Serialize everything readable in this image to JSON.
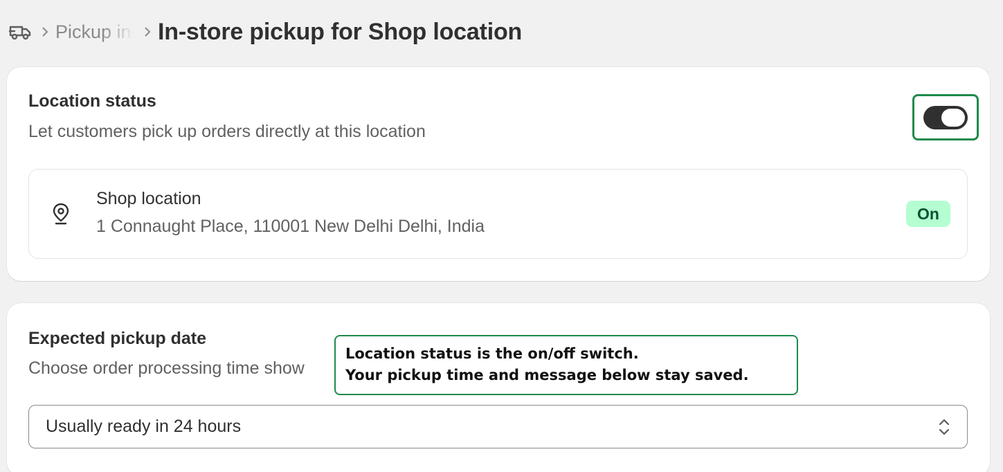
{
  "header": {
    "breadcrumb_link": "Pickup in-store",
    "title": "In-store pickup for Shop location"
  },
  "location_status": {
    "title": "Location status",
    "description": "Let customers pick up orders directly at this location",
    "toggle_on": true,
    "location": {
      "name": "Shop location",
      "address": "1 Connaught Place, 110001 New Delhi Delhi, India",
      "status": "On"
    }
  },
  "pickup_date": {
    "title": "Expected pickup date",
    "description": "Choose order processing time show",
    "select_value": "Usually ready in 24 hours"
  },
  "tooltip": {
    "line1": "Location status is the on/off switch.",
    "line2": "Your pickup time and message below stay saved."
  },
  "colors": {
    "accent_border": "#1f8a4c",
    "badge_bg": "#b4fed2",
    "badge_text": "#0c5132",
    "toggle_on": "#303030"
  },
  "icons": {
    "header": "truck-icon",
    "location": "map-pin-icon",
    "select": "select-chevrons-icon",
    "separator": "chevron-right-icon"
  }
}
